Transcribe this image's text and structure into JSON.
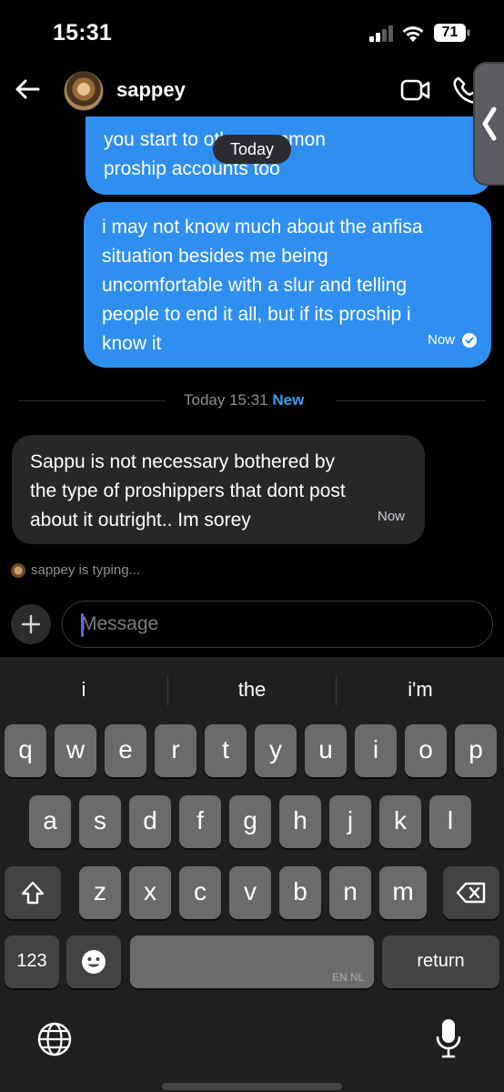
{
  "status_bar": {
    "time": "15:31",
    "battery": "71"
  },
  "header": {
    "contact_name": "sappey"
  },
  "messages": {
    "outgoing_1_text": "you start to        other common\nproship accounts too",
    "date_pill": "Today",
    "outgoing_2_text": "i may not know much about the anfisa\nsituation besides me being\nuncomfortable with a slur and telling\npeople to end it all, but if its proship i\nknow it",
    "outgoing_2_time": "Now",
    "divider_text": "Today 15:31",
    "divider_new": "New",
    "incoming_1_text": "Sappu is not necessary bothered by\nthe type of proshippers that dont post\nabout it outright.. Im sorey",
    "incoming_1_time": "Now",
    "typing_text": "sappey is typing..."
  },
  "composer": {
    "placeholder": "Message"
  },
  "keyboard": {
    "suggestions": [
      "i",
      "the",
      "i'm"
    ],
    "row1": [
      "q",
      "w",
      "e",
      "r",
      "t",
      "y",
      "u",
      "i",
      "o",
      "p"
    ],
    "row2": [
      "a",
      "s",
      "d",
      "f",
      "g",
      "h",
      "j",
      "k",
      "l"
    ],
    "row3": [
      "z",
      "x",
      "c",
      "v",
      "b",
      "n",
      "m"
    ],
    "numbers_label": "123",
    "space_language": "EN NL",
    "return_label": "return"
  }
}
